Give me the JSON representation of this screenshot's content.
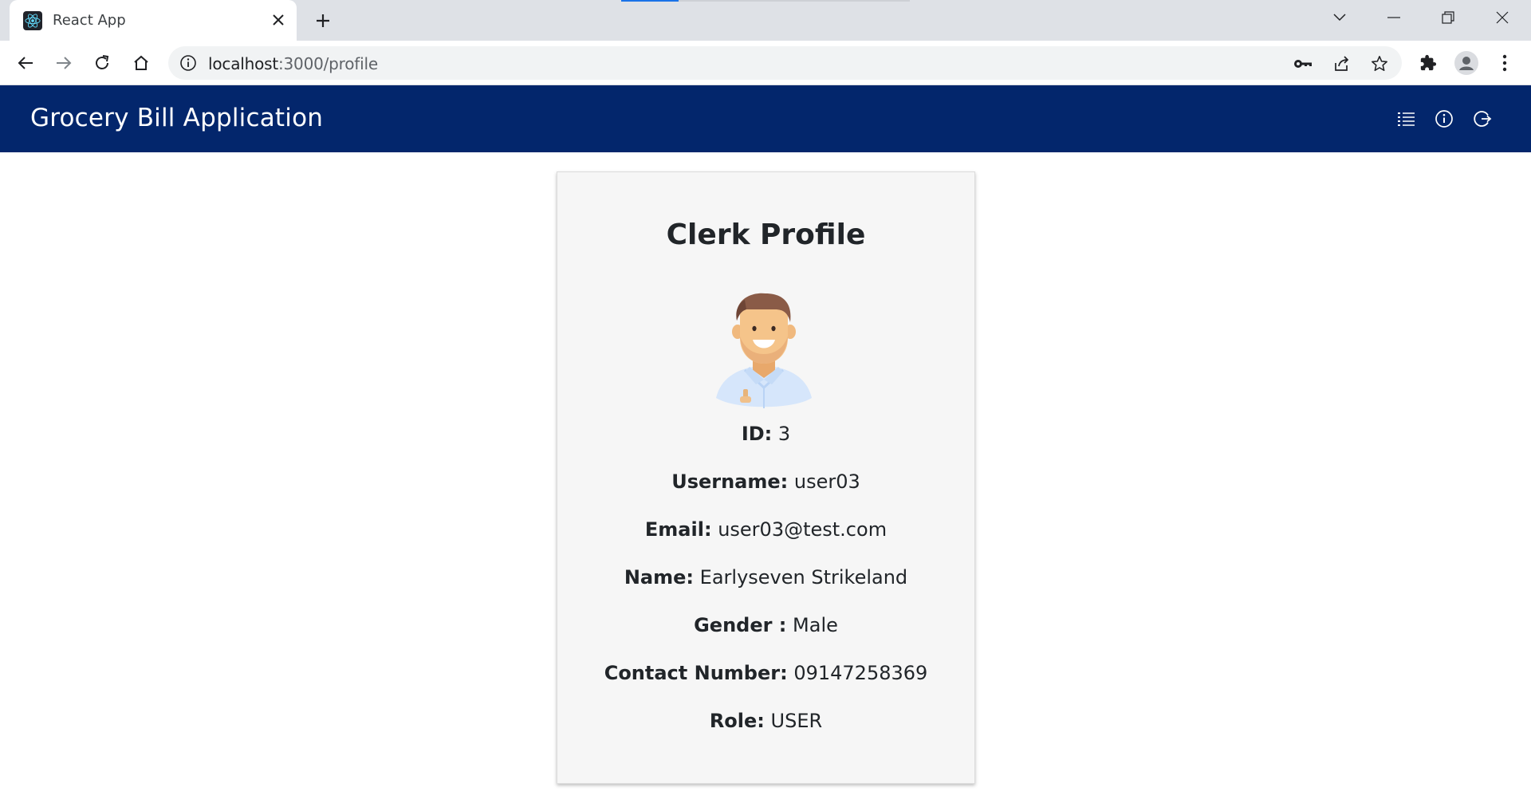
{
  "browser": {
    "tab_title": "React App",
    "url_host": "localhost",
    "url_path": ":3000/profile"
  },
  "header": {
    "title": "Grocery Bill Application",
    "icons": [
      "list-icon",
      "info-icon",
      "logout-icon"
    ]
  },
  "profile": {
    "title": "Clerk Profile",
    "fields": [
      {
        "label": "ID:",
        "value": "3"
      },
      {
        "label": "Username:",
        "value": "user03"
      },
      {
        "label": "Email:",
        "value": "user03@test.com"
      },
      {
        "label": "Name:",
        "value": "Earlyseven Strikeland"
      },
      {
        "label": "Gender :",
        "value": "Male"
      },
      {
        "label": "Contact Number:",
        "value": "09147258369"
      },
      {
        "label": "Role:",
        "value": "USER"
      }
    ]
  },
  "colors": {
    "header_bg": "#03266c",
    "card_bg": "#f6f6f6",
    "tabstrip_bg": "#dee1e6"
  }
}
